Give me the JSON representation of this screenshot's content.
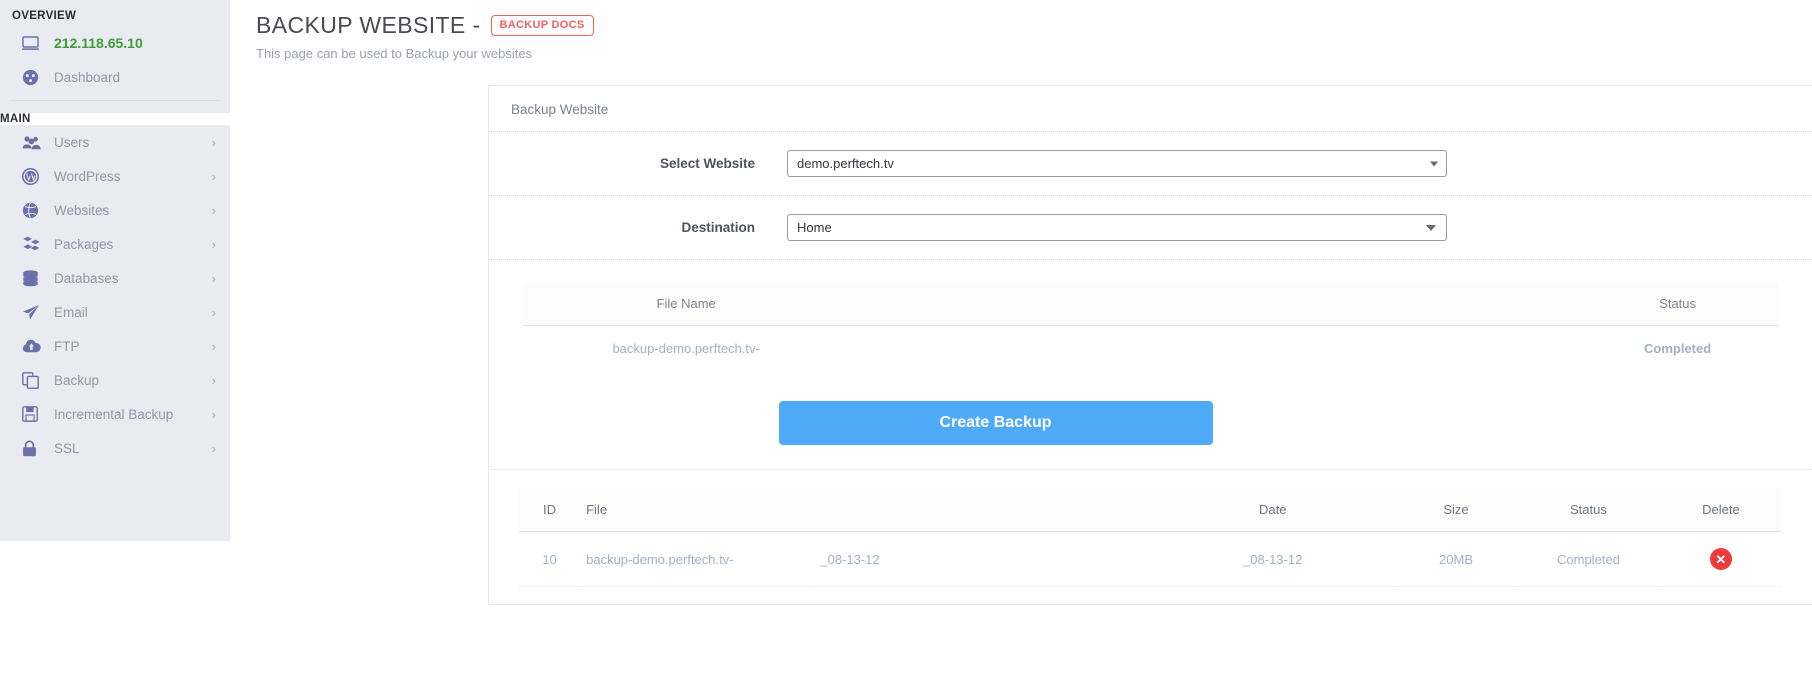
{
  "sidebar": {
    "overview_heading": "OVERVIEW",
    "main_heading": "MAIN",
    "overview_items": [
      {
        "label": "212.118.65.10",
        "icon": "monitor-icon",
        "chevron": false
      },
      {
        "label": "Dashboard",
        "icon": "dashboard-icon",
        "chevron": false
      }
    ],
    "main_items": [
      {
        "label": "Users",
        "icon": "users-icon",
        "chevron": "›"
      },
      {
        "label": "WordPress",
        "icon": "wordpress-icon",
        "chevron": "›"
      },
      {
        "label": "Websites",
        "icon": "globe-icon",
        "chevron": "›"
      },
      {
        "label": "Packages",
        "icon": "packages-icon",
        "chevron": "›"
      },
      {
        "label": "Databases",
        "icon": "database-icon",
        "chevron": "›"
      },
      {
        "label": "Email",
        "icon": "email-send-icon",
        "chevron": "›"
      },
      {
        "label": "FTP",
        "icon": "cloud-upload-icon",
        "chevron": "›"
      },
      {
        "label": "Backup",
        "icon": "copy-files-icon",
        "chevron": "›"
      },
      {
        "label": "Incremental Backup",
        "icon": "floppy-disk-icon",
        "chevron": "›"
      },
      {
        "label": "SSL",
        "icon": "lock-icon",
        "chevron": "›"
      }
    ]
  },
  "header": {
    "title": "BACKUP WEBSITE -",
    "docs_badge": "BACKUP DOCS",
    "subtitle": "This page can be used to Backup your websites"
  },
  "card": {
    "title": "Backup Website",
    "select_website": {
      "label": "Select Website",
      "value": "demo.perftech.tv"
    },
    "destination": {
      "label": "Destination",
      "value": "Home"
    },
    "progress_table": {
      "headers": [
        "File Name",
        "Status"
      ],
      "rows": [
        {
          "file_name": "backup-demo.perftech.tv-",
          "status": "Completed"
        }
      ]
    },
    "create_button": "Create Backup",
    "backups_table": {
      "headers": [
        "ID",
        "File",
        "Date",
        "Size",
        "Status",
        "Delete"
      ],
      "rows": [
        {
          "id": "10",
          "file": "backup-demo.perftech.tv-",
          "file_suffix": "_08-13-12",
          "date": "_08-13-12",
          "size": "20MB",
          "status": "Completed",
          "delete_icon": "✕"
        }
      ]
    }
  },
  "colors": {
    "accent_blue": "#4fabf7",
    "danger_red": "#ee3b3b",
    "status_red": "#e02020",
    "ip_green": "#3f9c35",
    "badge_red": "#f0625f"
  }
}
